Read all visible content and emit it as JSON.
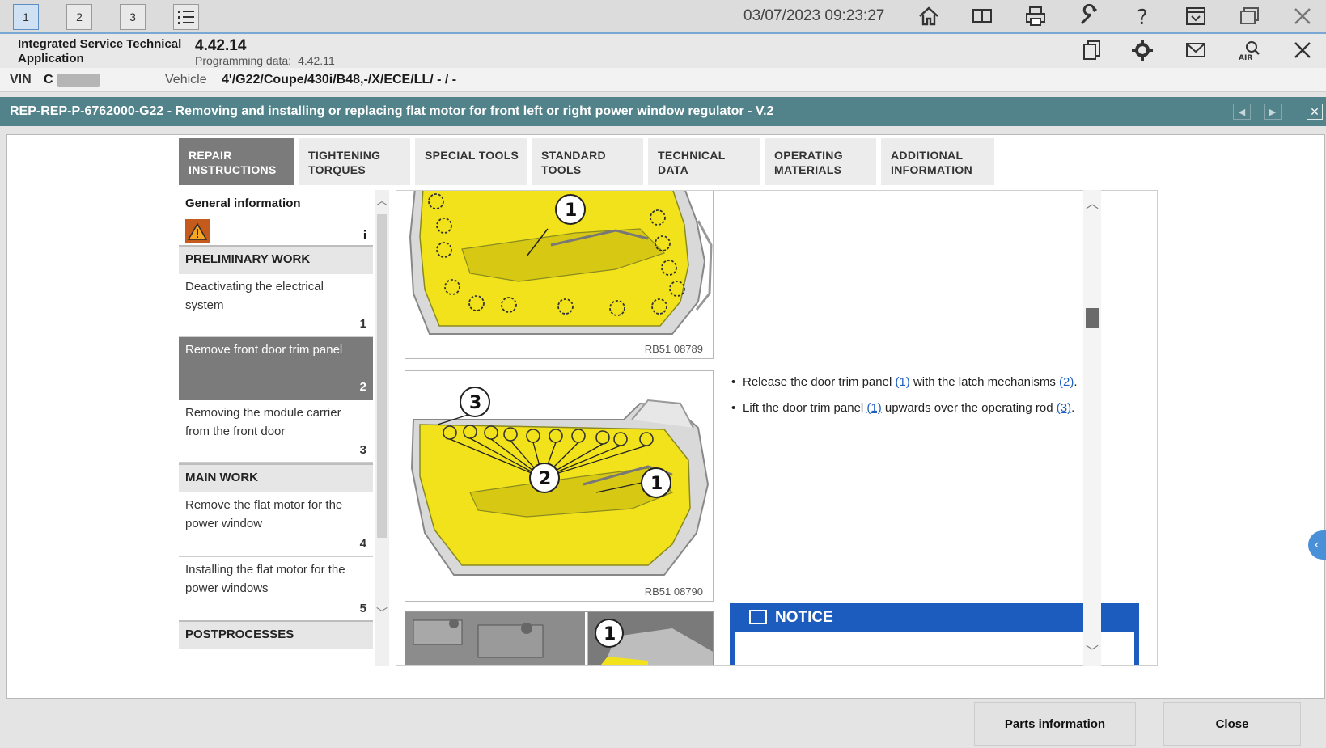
{
  "toolbar": {
    "tabs": [
      "1",
      "2",
      "3"
    ],
    "datetime": "03/07/2023 09:23:27"
  },
  "app": {
    "name": "Integrated Service Technical Application",
    "version": "4.42.14",
    "programming_label": "Programming data:",
    "programming_value": "4.42.11"
  },
  "vehicle": {
    "vin_label": "VIN",
    "vin_value": "C",
    "vehicle_label": "Vehicle",
    "vehicle_value": "4'/G22/Coupe/430i/B48,-/X/ECE/LL/ - / -"
  },
  "document": {
    "title": "REP-REP-P-6762000-G22 - Removing and installing or replacing flat motor for front left or right power window regulator - V.2"
  },
  "tabs": [
    {
      "line1": "REPAIR",
      "line2": "INSTRUCTIONS"
    },
    {
      "line1": "TIGHTENING",
      "line2": "TORQUES"
    },
    {
      "line1": "SPECIAL TOOLS",
      "line2": ""
    },
    {
      "line1": "STANDARD",
      "line2": "TOOLS"
    },
    {
      "line1": "TECHNICAL",
      "line2": "DATA"
    },
    {
      "line1": "OPERATING",
      "line2": "MATERIALS"
    },
    {
      "line1": "ADDITIONAL",
      "line2": "INFORMATION"
    }
  ],
  "nav": {
    "general_title": "General information",
    "general_info_mark": "i",
    "sections": [
      "PRELIMINARY WORK",
      "MAIN WORK",
      "POSTPROCESSES"
    ],
    "items": [
      {
        "label": "Deactivating the electrical system",
        "num": "1"
      },
      {
        "label": "Remove front door trim panel",
        "num": "2"
      },
      {
        "label": "Removing the module carrier from the front door",
        "num": "3"
      },
      {
        "label": "Remove the flat motor for the power window",
        "num": "4"
      },
      {
        "label": "Installing the flat motor for the power windows",
        "num": "5"
      }
    ]
  },
  "content": {
    "figure1_caption": "RB51 08789",
    "figure2_caption": "RB51 08790",
    "callouts": [
      "1",
      "2",
      "3"
    ],
    "bullet1_pre": "Release the door trim panel ",
    "bullet1_ref1": "(1)",
    "bullet1_mid": " with the latch mechanisms ",
    "bullet1_ref2": "(2)",
    "bullet1_post": ".",
    "bullet2_pre": "Lift the door trim panel ",
    "bullet2_ref1": "(1)",
    "bullet2_mid": " upwards over the operating rod ",
    "bullet2_ref2": "(3)",
    "bullet2_post": ".",
    "notice_title": "NOTICE"
  },
  "buttons": {
    "parts": "Parts information",
    "close": "Close"
  },
  "colors": {
    "title_bar": "#52828a",
    "active_tab": "#7b7b7b",
    "notice": "#1c5cbf",
    "trim_yellow": "#f2e21b"
  }
}
